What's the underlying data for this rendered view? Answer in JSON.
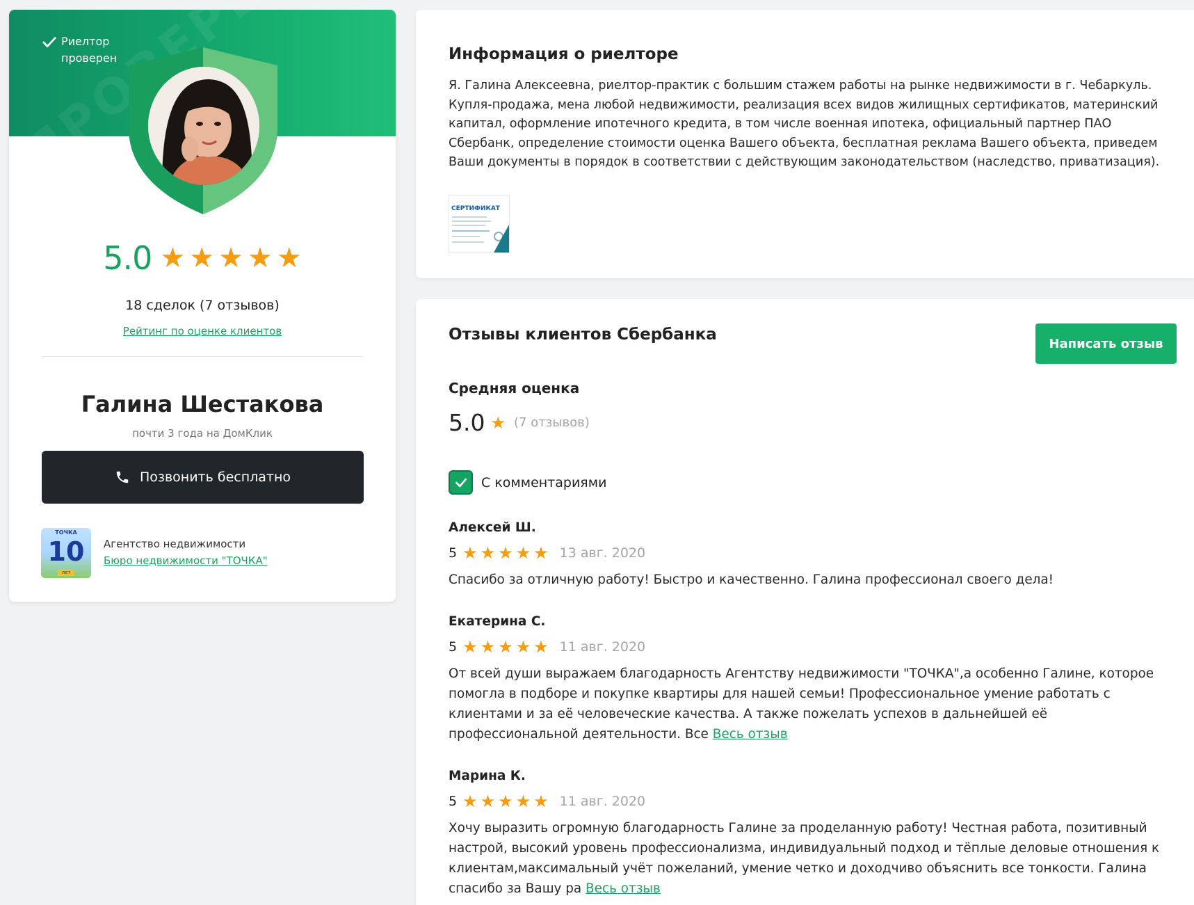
{
  "profile": {
    "verified_label": "Риелтор проверен",
    "rating": "5.0",
    "stars": 5,
    "deals": "18 сделок (7 отзывов)",
    "rating_link": "Рейтинг по оценке клиентов",
    "name": "Галина Шестакова",
    "experience": "почти 3 года на ДомКлик",
    "call_button": "Позвонить бесплатно",
    "agency_type": "Агентство недвижимости",
    "agency_name": "Бюро недвижимости \"ТОЧКА\"",
    "agency_logo_text": "ТОЧКА",
    "agency_logo_number": "10",
    "agency_logo_badge": "лет"
  },
  "info": {
    "title": "Информация о риелторе",
    "text": "Я. Галина Алексеевна, риелтор-практик с большим стажем работы на рынке недвижимости в г. Чебаркуль. Купля-продажа, мена любой недвижимости, реализация всех видов жилищных сертификатов, материнский капитал, оформление ипотечного кредита, в том числе военная ипотека, официальный партнер ПАО Сбербанк, определение стоимости оценка Вашего объекта, бесплатная реклама Вашего объекта, приведем Ваши документы в порядок в соответствии с действующим законодательством (наследство, приватизация).",
    "certificate_title": "СЕРТИФИКАТ"
  },
  "reviews": {
    "title": "Отзывы клиентов Сбербанка",
    "write_button": "Написать отзыв",
    "avg_label": "Средняя оценка",
    "avg_value": "5.0",
    "avg_count": "(7 отзывов)",
    "filter_label": "С комментариями",
    "filter_checked": true,
    "items": [
      {
        "author": "Алексей Ш.",
        "score": "5",
        "date": "13 авг. 2020",
        "text": "Спасибо за отличную работу! Быстро и качественно. Галина профессионал своего дела!",
        "more": ""
      },
      {
        "author": "Екатерина С.",
        "score": "5",
        "date": "11 авг. 2020",
        "text": "От всей души выражаем благодарность Агентству недвижимости \"ТОЧКА\",а особенно Галине, которое помогла в подборе и покупке квартиры для нашей семьи! Профессиональное умение работать с клиентами и за её человеческие качества. А также пожелать успехов в дальнейшей её профессиональной деятельности. Все ",
        "more": "Весь отзыв"
      },
      {
        "author": "Марина К.",
        "score": "5",
        "date": "11 авг. 2020",
        "text": "Хочу выразить огромную благодарность Галине за проделанную работу! Честная работа, позитивный настрой, высокий уровень профессионализма, индивидуальный подход и тёплые деловые отношения к клиентам,максимальный учёт пожеланий, умение четко и доходчиво объяснить все тонкости. Галина спасибо за Вашу ра ",
        "more": "Весь отзыв"
      }
    ]
  },
  "colors": {
    "brand_green": "#16a35f",
    "star": "#f59c12",
    "dark_button": "#21262b"
  },
  "icons": {
    "verified": "check-icon",
    "call": "phone-icon",
    "star": "star-icon",
    "filter": "checkmark-icon"
  }
}
